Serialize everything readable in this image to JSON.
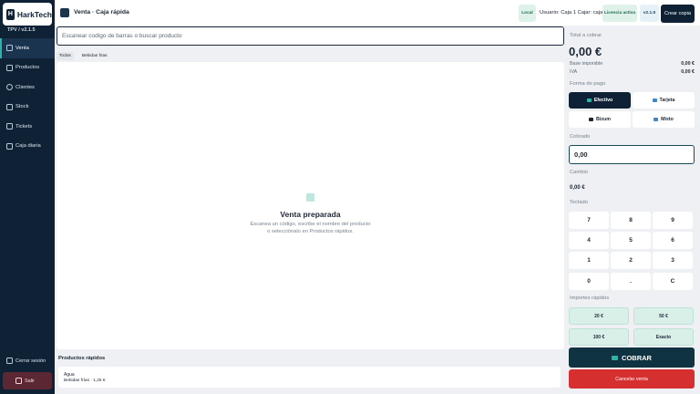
{
  "sidebar": {
    "logo_mark": "H",
    "logo": "HarkTech",
    "version_line": "TPV  /  v2.1.5",
    "items": [
      {
        "label": "Venta",
        "icon": "grid-icon"
      },
      {
        "label": "Productos",
        "icon": "box-icon"
      },
      {
        "label": "Clientes",
        "icon": "users-icon"
      },
      {
        "label": "Stock",
        "icon": "stack-icon"
      },
      {
        "label": "Tickets",
        "icon": "ticket-icon"
      },
      {
        "label": "Caja diaria",
        "icon": "grid-icon"
      }
    ],
    "logout": "Cerrar sesión",
    "exit": "Salir"
  },
  "header": {
    "title": "Venta · Caja rápida",
    "local": "Local",
    "user": "Usuario: Caja 1  Cajar: caja1",
    "license": "Licencia activa",
    "version": "v2.1.5",
    "copy": "Crear copia"
  },
  "search": {
    "placeholder": "Escanear codigo de barras o buscar producto"
  },
  "categories": [
    "Todos",
    "Bebidas frias"
  ],
  "empty": {
    "title": "Venta preparada",
    "line1": "Escanea un código, escribe el nombre del producto",
    "line2": "o selecciónalo en Productos rápidos."
  },
  "quick": {
    "title": "Productos rápidos",
    "items": [
      {
        "name": "Agua",
        "sub": "Bebidas frías  ·  1,25 €"
      }
    ]
  },
  "totals": {
    "label": "Total a cobrar",
    "total": "0,00 €",
    "base_label": "Base imponible",
    "base": "0,00 €",
    "iva_label": "IVA",
    "iva": "0,00 €"
  },
  "payment": {
    "label": "Forma de pago",
    "methods": [
      "Efectivo",
      "Tarjeta",
      "Bizum",
      "Mixto"
    ]
  },
  "cobrado": {
    "label": "Cobrado",
    "value": "0,00"
  },
  "cambio": {
    "label": "Cambio",
    "value": "0,00 €"
  },
  "keypad": {
    "label": "Teclado",
    "keys": [
      "7",
      "8",
      "9",
      "4",
      "5",
      "6",
      "1",
      "2",
      "3",
      "0",
      ".",
      "C"
    ]
  },
  "amounts": {
    "label": "Importes rápidos",
    "items": [
      "20 €",
      "50 €",
      "100 €",
      "Exacto"
    ]
  },
  "actions": {
    "charge": "COBRAR",
    "cancel": "Cancelar venta"
  },
  "colors": {
    "navy": "#0f2235",
    "teal": "#2bb5a2",
    "danger": "#d62f2f",
    "mint": "#d9f0e9"
  }
}
